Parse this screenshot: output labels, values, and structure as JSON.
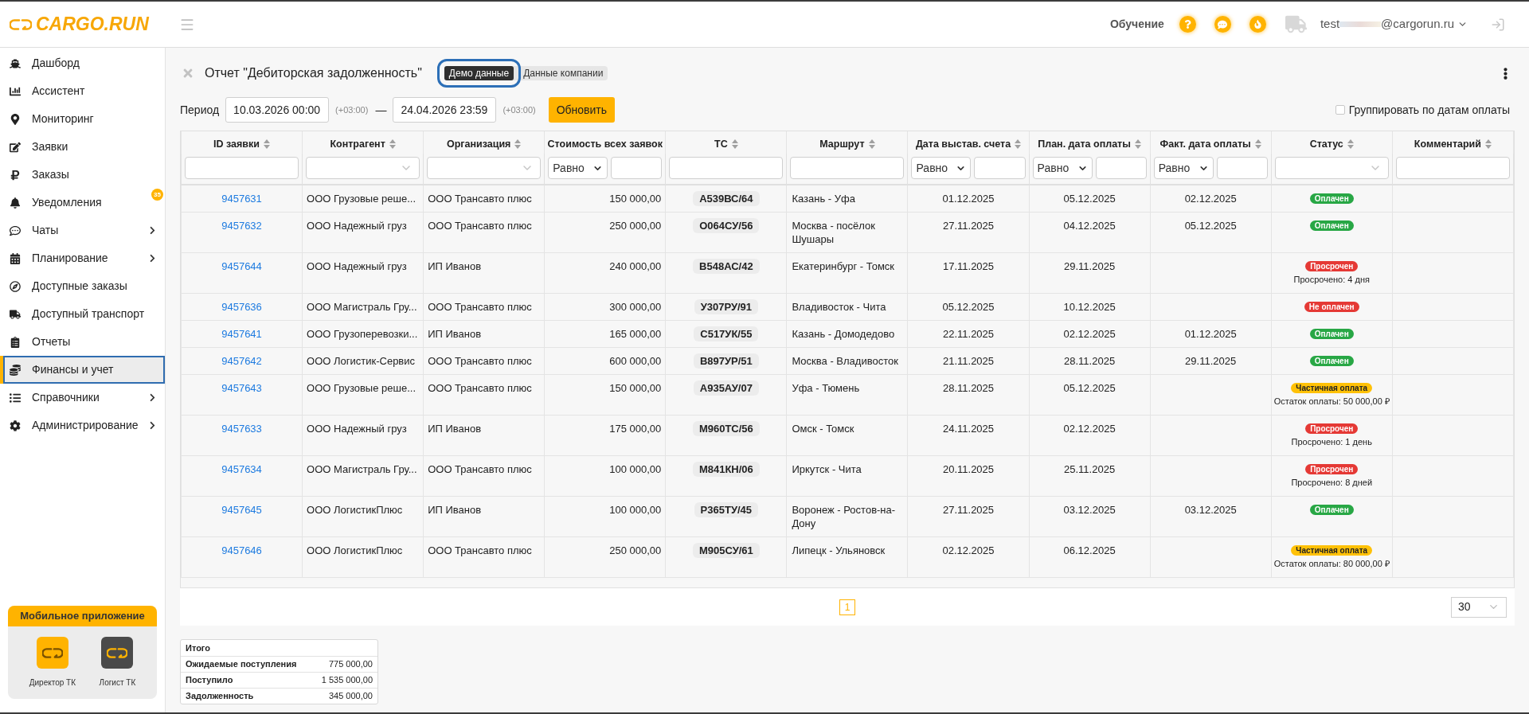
{
  "header": {
    "logo": "CARGO.RUN",
    "training_link": "Обучение",
    "user": {
      "email_start": "test",
      "email_end": "@cargorun.ru"
    }
  },
  "sidebar": {
    "items": [
      {
        "label": "Дашборд",
        "expandable": false,
        "selected": false
      },
      {
        "label": "Ассистент",
        "expandable": false,
        "selected": false
      },
      {
        "label": "Мониторинг",
        "expandable": false,
        "selected": false
      },
      {
        "label": "Заявки",
        "expandable": false,
        "selected": false
      },
      {
        "label": "Заказы",
        "expandable": false,
        "selected": false
      },
      {
        "label": "Уведомления",
        "badge": "35",
        "expandable": false,
        "selected": false
      },
      {
        "label": "Чаты",
        "expandable": true,
        "selected": false
      },
      {
        "label": "Планирование",
        "expandable": true,
        "selected": false
      },
      {
        "label": "Доступные заказы",
        "expandable": false,
        "selected": false
      },
      {
        "label": "Доступный транспорт",
        "expandable": false,
        "selected": false
      },
      {
        "label": "Отчеты",
        "expandable": false,
        "selected": false
      },
      {
        "label": "Финансы и учет",
        "expandable": false,
        "selected": true
      },
      {
        "label": "Справочники",
        "expandable": true,
        "selected": false
      },
      {
        "label": "Администрирование",
        "expandable": true,
        "selected": false
      }
    ],
    "mobile_app": {
      "title": "Мобильное приложение",
      "apps": [
        {
          "label": "Директор ТК",
          "color": "#ffb300"
        },
        {
          "label": "Логист ТК",
          "color": "#4a4a4a"
        }
      ]
    }
  },
  "report": {
    "title": "Отчет \"Дебиторская задолженность\"",
    "data_sources": [
      {
        "label": "Демо данные",
        "selected": true
      },
      {
        "label": "Данные компании",
        "selected": false
      }
    ],
    "period": {
      "label": "Период",
      "from": "10.03.2026 00:00",
      "from_offset": "(+03:00)",
      "separator": "—",
      "to": "24.04.2026 23:59",
      "to_offset": "(+03:00)"
    },
    "refresh_button": "Обновить",
    "group_by_payment_dates": {
      "label": "Группировать по датам оплаты",
      "checked": false
    }
  },
  "table": {
    "columns": [
      {
        "label": "ID заявки",
        "sortable": true,
        "filter": {
          "kind": "text"
        }
      },
      {
        "label": "Контрагент",
        "sortable": true,
        "filter": {
          "kind": "select"
        }
      },
      {
        "label": "Организация",
        "sortable": true,
        "filter": {
          "kind": "select"
        }
      },
      {
        "label": "Стоимость всех заявок",
        "sortable": false,
        "filter": {
          "kind": "compare",
          "operator": "Равно"
        }
      },
      {
        "label": "ТС",
        "sortable": true,
        "filter": {
          "kind": "text"
        }
      },
      {
        "label": "Маршрут",
        "sortable": true,
        "filter": {
          "kind": "text"
        }
      },
      {
        "label": "Дата выстав. счета",
        "sortable": true,
        "filter": {
          "kind": "compare",
          "operator": "Равно"
        }
      },
      {
        "label": "План. дата оплаты",
        "sortable": true,
        "filter": {
          "kind": "compare",
          "operator": "Равно"
        }
      },
      {
        "label": "Факт. дата оплаты",
        "sortable": true,
        "filter": {
          "kind": "compare",
          "operator": "Равно"
        }
      },
      {
        "label": "Статус",
        "sortable": true,
        "filter": {
          "kind": "select"
        }
      },
      {
        "label": "Комментарий",
        "sortable": true,
        "filter": {
          "kind": "text"
        }
      }
    ],
    "rows": [
      {
        "id": "9457631",
        "counterparty": "ООО Грузовые реше...",
        "organization": "ООО Трансавто плюс",
        "total_cost": "150 000,00",
        "vehicle": "А539ВС/64",
        "route": "Казань - Уфа",
        "invoice_date": "01.12.2025",
        "planned_payment_date": "05.12.2025",
        "actual_payment_date": "02.12.2025",
        "status": {
          "label": "Оплачен",
          "kind": "paid"
        }
      },
      {
        "id": "9457632",
        "counterparty": "ООО Надежный груз",
        "organization": "ООО Трансавто плюс",
        "total_cost": "250 000,00",
        "vehicle": "О064СУ/56",
        "route": "Москва - посёлок Шушары",
        "invoice_date": "27.11.2025",
        "planned_payment_date": "04.12.2025",
        "actual_payment_date": "05.12.2025",
        "status": {
          "label": "Оплачен",
          "kind": "paid"
        }
      },
      {
        "id": "9457644",
        "counterparty": "ООО Надежный груз",
        "organization": "ИП Иванов",
        "total_cost": "240 000,00",
        "vehicle": "В548АС/42",
        "route": "Екатеринбург - Томск",
        "invoice_date": "17.11.2025",
        "planned_payment_date": "29.11.2025",
        "status": {
          "label": "Просрочен",
          "kind": "overdue"
        },
        "status_note": "Просрочено: 4 дня"
      },
      {
        "id": "9457636",
        "counterparty": "ООО Магистраль Гру...",
        "organization": "ООО Трансавто плюс",
        "total_cost": "300 000,00",
        "vehicle": "У307РУ/91",
        "route": "Владивосток - Чита",
        "invoice_date": "05.12.2025",
        "planned_payment_date": "10.12.2025",
        "status": {
          "label": "Не оплачен",
          "kind": "unpaid"
        }
      },
      {
        "id": "9457641",
        "counterparty": "ООО Грузоперевозки...",
        "organization": "ИП Иванов",
        "total_cost": "165 000,00",
        "vehicle": "С517УК/55",
        "route": "Казань - Домодедово",
        "invoice_date": "22.11.2025",
        "planned_payment_date": "02.12.2025",
        "actual_payment_date": "01.12.2025",
        "status": {
          "label": "Оплачен",
          "kind": "paid"
        }
      },
      {
        "id": "9457642",
        "counterparty": "ООО Логистик-Сервис",
        "organization": "ООО Трансавто плюс",
        "total_cost": "600 000,00",
        "vehicle": "В897УР/51",
        "route": "Москва - Владивосток",
        "invoice_date": "21.11.2025",
        "planned_payment_date": "28.11.2025",
        "actual_payment_date": "29.11.2025",
        "status": {
          "label": "Оплачен",
          "kind": "paid"
        }
      },
      {
        "id": "9457643",
        "counterparty": "ООО Грузовые реше...",
        "organization": "ООО Трансавто плюс",
        "total_cost": "150 000,00",
        "vehicle": "А935АУ/07",
        "route": "Уфа - Тюмень",
        "invoice_date": "28.11.2025",
        "planned_payment_date": "05.12.2025",
        "status": {
          "label": "Частичная оплата",
          "kind": "partial"
        },
        "status_note": "Остаток оплаты: 50 000,00 ₽"
      },
      {
        "id": "9457633",
        "counterparty": "ООО Надежный груз",
        "organization": "ИП Иванов",
        "total_cost": "175 000,00",
        "vehicle": "М960ТС/56",
        "route": "Омск - Томск",
        "invoice_date": "24.11.2025",
        "planned_payment_date": "02.12.2025",
        "status": {
          "label": "Просрочен",
          "kind": "overdue"
        },
        "status_note": "Просрочено: 1 день"
      },
      {
        "id": "9457634",
        "counterparty": "ООО Магистраль Гру...",
        "organization": "ООО Трансавто плюс",
        "total_cost": "100 000,00",
        "vehicle": "М841КН/06",
        "route": "Иркутск - Чита",
        "invoice_date": "20.11.2025",
        "planned_payment_date": "25.11.2025",
        "status": {
          "label": "Просрочен",
          "kind": "overdue"
        },
        "status_note": "Просрочено: 8 дней"
      },
      {
        "id": "9457645",
        "counterparty": "ООО ЛогистикПлюс",
        "organization": "ИП Иванов",
        "total_cost": "100 000,00",
        "vehicle": "Р365ТУ/45",
        "route": "Воронеж - Ростов-на-Дону",
        "invoice_date": "27.11.2025",
        "planned_payment_date": "03.12.2025",
        "actual_payment_date": "03.12.2025",
        "status": {
          "label": "Оплачен",
          "kind": "paid"
        }
      },
      {
        "id": "9457646",
        "counterparty": "ООО ЛогистикПлюс",
        "organization": "ООО Трансавто плюс",
        "total_cost": "250 000,00",
        "vehicle": "М905СУ/61",
        "route": "Липецк - Ульяновск",
        "invoice_date": "02.12.2025",
        "planned_payment_date": "06.12.2025",
        "status": {
          "label": "Частичная оплата",
          "kind": "partial"
        },
        "status_note": "Остаток оплаты: 80 000,00 ₽"
      }
    ]
  },
  "pagination": {
    "pages": [
      {
        "label": "1",
        "selected": true
      }
    ],
    "page_size": "30"
  },
  "totals": {
    "title": "Итого",
    "rows": [
      {
        "label": "Ожидаемые поступления",
        "value": "775 000,00"
      },
      {
        "label": "Поступило",
        "value": "1 535 000,00"
      },
      {
        "label": "Задолженность",
        "value": "345 000,00"
      }
    ]
  }
}
